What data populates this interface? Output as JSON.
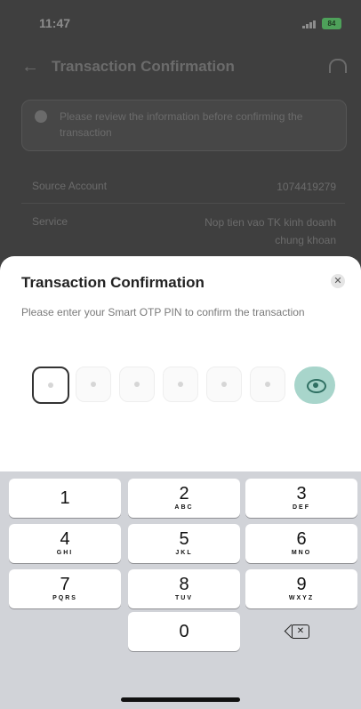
{
  "status_bar": {
    "time": "11:47",
    "battery": "84"
  },
  "background": {
    "title": "Transaction Confirmation",
    "info_text": "Please review the information before confirming the transaction",
    "rows": [
      {
        "label": "Source Account",
        "value": "1074419279"
      },
      {
        "label": "Service",
        "value": "Nop tien vao TK kinh doanh chung khoan"
      }
    ]
  },
  "sheet": {
    "title": "Transaction Confirmation",
    "subtitle": "Please enter your Smart OTP PIN to confirm the transaction",
    "close_icon": "close-icon",
    "pin_length": 6
  },
  "keypad": {
    "keys": [
      {
        "digit": "1",
        "letters": ""
      },
      {
        "digit": "2",
        "letters": "ABC"
      },
      {
        "digit": "3",
        "letters": "DEF"
      },
      {
        "digit": "4",
        "letters": "GHI"
      },
      {
        "digit": "5",
        "letters": "JKL"
      },
      {
        "digit": "6",
        "letters": "MNO"
      },
      {
        "digit": "7",
        "letters": "PQRS"
      },
      {
        "digit": "8",
        "letters": "TUV"
      },
      {
        "digit": "9",
        "letters": "WXYZ"
      },
      {
        "digit": "0",
        "letters": ""
      }
    ],
    "backspace_icon": "backspace-icon"
  },
  "colors": {
    "accent": "#a8d5cb",
    "accent_dark": "#2f6f62",
    "overlay": "#3f3f3f",
    "keypad_bg": "#d1d3d8"
  }
}
